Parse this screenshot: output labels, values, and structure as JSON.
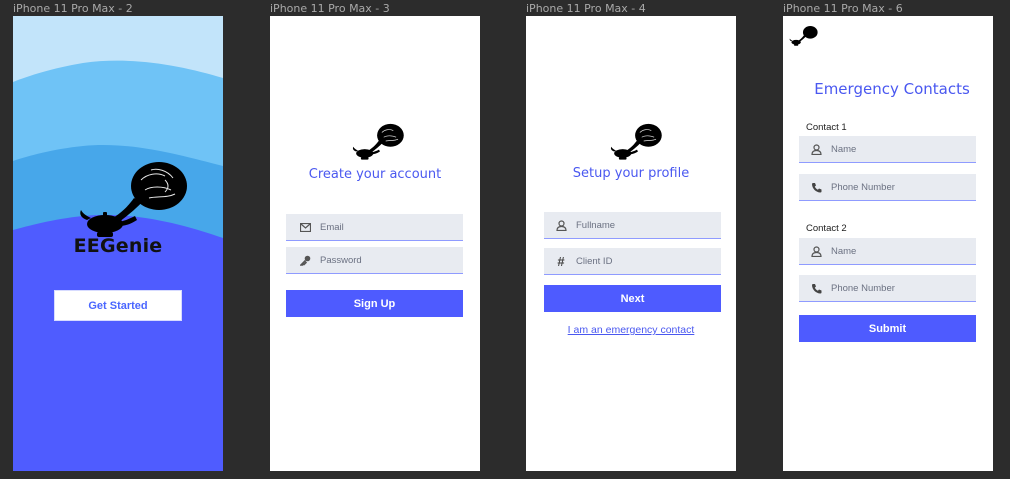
{
  "frames": [
    {
      "label": "iPhone 11 Pro Max - 2"
    },
    {
      "label": "iPhone 11 Pro Max - 3"
    },
    {
      "label": "iPhone 11 Pro Max - 4"
    },
    {
      "label": "iPhone 11 Pro Max - 6"
    }
  ],
  "splash": {
    "brand": "EEGenie",
    "get_started_label": "Get Started"
  },
  "signup": {
    "title": "Create your account",
    "email_placeholder": "Email",
    "password_placeholder": "Password",
    "signup_label": "Sign Up"
  },
  "profile": {
    "title": "Setup your profile",
    "fullname_placeholder": "Fullname",
    "client_id_placeholder": "Client ID",
    "next_label": "Next",
    "emergency_link": "I am an emergency contact"
  },
  "emergency": {
    "title": "Emergency Contacts",
    "contact1_label": "Contact 1",
    "contact2_label": "Contact 2",
    "name_placeholder": "Name",
    "phone_placeholder": "Phone Number",
    "submit_label": "Submit"
  },
  "colors": {
    "accent": "#4e5bff",
    "title_blue": "#4a58f0",
    "field_bg": "#e8ebf1",
    "canvas": "#2c2c2c"
  },
  "icons": [
    "lamp-brain-logo",
    "email-icon",
    "key-icon",
    "user-icon",
    "hash-icon",
    "phone-icon"
  ]
}
